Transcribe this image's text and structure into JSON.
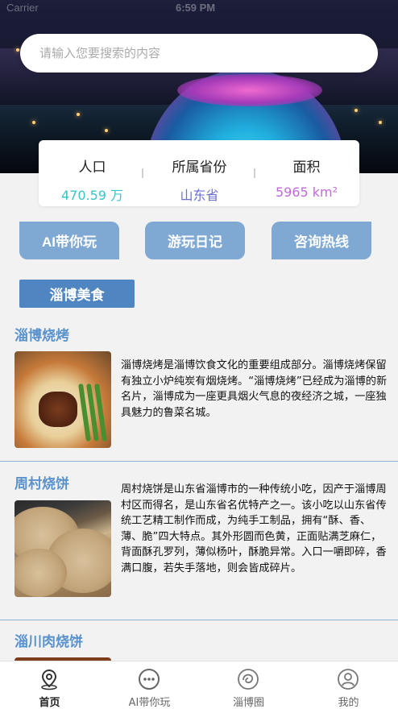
{
  "status_bar": {
    "carrier": "Carrier",
    "time": "6:59 PM"
  },
  "search": {
    "placeholder": "请输入您要搜索的内容"
  },
  "stats": [
    {
      "label": "人口",
      "value": "470.59 万"
    },
    {
      "label": "所属省份",
      "value": "山东省"
    },
    {
      "label": "面积",
      "value": "5965 km²"
    }
  ],
  "actions": [
    {
      "label": "AI带你玩"
    },
    {
      "label": "游玩日记"
    },
    {
      "label": "咨询热线"
    }
  ],
  "category_tab": "淄博美食",
  "foods": [
    {
      "title": "淄博烧烤",
      "desc": "淄博烧烤是淄博饮食文化的重要组成部分。淄博烧烤保留有独立小炉纯炭有烟烧烤。“淄博烧烤”已经成为淄博的新名片，淄博成为一座更具烟火气息的夜经济之城，一座独具魅力的鲁菜名城。"
    },
    {
      "title": "周村烧饼",
      "desc": "周村烧饼是山东省淄博市的一种传统小吃，因产于淄博周村区而得名，是山东省名优特产之一。该小吃以山东省传统工艺精工制作而成，为纯手工制品，拥有“酥、香、薄、脆”四大特点。其外形圆而色黄，正面贴满芝麻仁，背面酥孔罗列，薄似杨叶，酥脆异常。入口一嚼即碎，香满口腹，若失手落地，则会皆成碎片。"
    },
    {
      "title": "淄川肉烧饼",
      "desc": ""
    }
  ],
  "tabbar": [
    {
      "label": "首页",
      "icon": "location-pin-icon",
      "active": true
    },
    {
      "label": "AI带你玩",
      "icon": "chat-dots-icon",
      "active": false
    },
    {
      "label": "淄博圈",
      "icon": "circle-swirl-icon",
      "active": false
    },
    {
      "label": "我的",
      "icon": "user-icon",
      "active": false
    }
  ],
  "colors": {
    "accent": "#4f86c2",
    "button": "#7fa9d3",
    "title": "#5a92cc",
    "population": "#36c5c8",
    "province": "#6a6fd4",
    "area": "#c06ad8"
  }
}
